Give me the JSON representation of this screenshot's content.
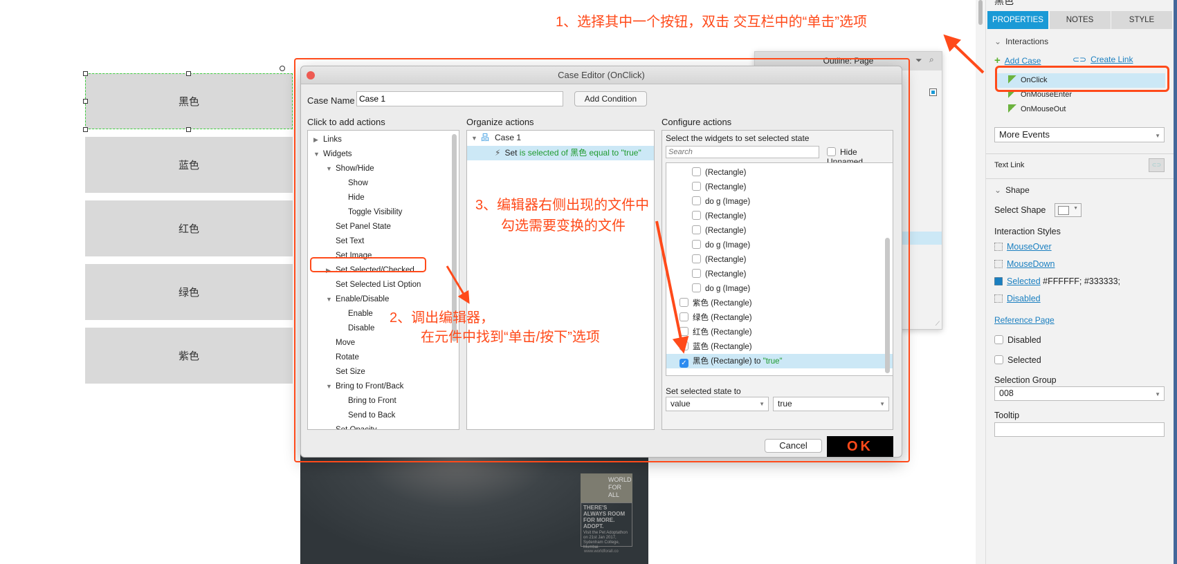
{
  "canvas": {
    "buttons": [
      "黑色",
      "蓝色",
      "红色",
      "绿色",
      "紫色"
    ]
  },
  "outline_panel": {
    "title": "Outline: Page"
  },
  "dialog": {
    "title": "Case Editor (OnClick)",
    "case_name_label": "Case Name",
    "case_name_value": "Case 1",
    "add_condition": "Add Condition",
    "left": {
      "header": "Click to add actions",
      "items": [
        {
          "label": "Links",
          "level": 0,
          "tri": "▶"
        },
        {
          "label": "Widgets",
          "level": 0,
          "tri": "▼"
        },
        {
          "label": "Show/Hide",
          "level": 1,
          "tri": "▼"
        },
        {
          "label": "Show",
          "level": 2,
          "tri": ""
        },
        {
          "label": "Hide",
          "level": 2,
          "tri": ""
        },
        {
          "label": "Toggle Visibility",
          "level": 2,
          "tri": ""
        },
        {
          "label": "Set Panel State",
          "level": 1,
          "tri": ""
        },
        {
          "label": "Set Text",
          "level": 1,
          "tri": ""
        },
        {
          "label": "Set Image",
          "level": 1,
          "tri": ""
        },
        {
          "label": "Set Selected/Checked",
          "level": 1,
          "tri": "▶"
        },
        {
          "label": "Set Selected List Option",
          "level": 1,
          "tri": ""
        },
        {
          "label": "Enable/Disable",
          "level": 1,
          "tri": "▼"
        },
        {
          "label": "Enable",
          "level": 2,
          "tri": ""
        },
        {
          "label": "Disable",
          "level": 2,
          "tri": ""
        },
        {
          "label": "Move",
          "level": 1,
          "tri": ""
        },
        {
          "label": "Rotate",
          "level": 1,
          "tri": ""
        },
        {
          "label": "Set Size",
          "level": 1,
          "tri": ""
        },
        {
          "label": "Bring to Front/Back",
          "level": 1,
          "tri": "▼"
        },
        {
          "label": "Bring to Front",
          "level": 2,
          "tri": ""
        },
        {
          "label": "Send to Back",
          "level": 2,
          "tri": ""
        },
        {
          "label": "Set Opacity",
          "level": 1,
          "tri": ""
        }
      ]
    },
    "middle": {
      "header": "Organize actions",
      "case_label": "Case 1",
      "action_verb": "Set",
      "action_detail": "is selected of 黑色 equal to \"true\""
    },
    "right": {
      "header": "Configure actions",
      "subheader": "Select the widgets to set selected state",
      "search_placeholder": "Search",
      "hide_unnamed": "Hide Unnamed",
      "widgets": [
        {
          "label": "(Rectangle)",
          "indent": 2,
          "checked": false
        },
        {
          "label": "(Rectangle)",
          "indent": 2,
          "checked": false
        },
        {
          "label": "do g (Image)",
          "indent": 2,
          "checked": false
        },
        {
          "label": "(Rectangle)",
          "indent": 2,
          "checked": false
        },
        {
          "label": "(Rectangle)",
          "indent": 2,
          "checked": false
        },
        {
          "label": "do g (Image)",
          "indent": 2,
          "checked": false
        },
        {
          "label": "(Rectangle)",
          "indent": 2,
          "checked": false
        },
        {
          "label": "(Rectangle)",
          "indent": 2,
          "checked": false
        },
        {
          "label": "do g (Image)",
          "indent": 2,
          "checked": false
        },
        {
          "label": "紫色 (Rectangle)",
          "indent": 1,
          "checked": false
        },
        {
          "label": "绿色 (Rectangle)",
          "indent": 1,
          "checked": false
        },
        {
          "label": "红色 (Rectangle)",
          "indent": 1,
          "checked": false
        },
        {
          "label": "蓝色 (Rectangle)",
          "indent": 1,
          "checked": false
        },
        {
          "label": "黑色 (Rectangle)",
          "indent": 1,
          "checked": true,
          "suffix": " to ",
          "value": "\"true\""
        }
      ],
      "set_state_label": "Set selected state to",
      "mode_value": "value",
      "state_value": "true"
    },
    "cancel": "Cancel",
    "ok": "OK"
  },
  "poster": {
    "logo": "WORLD FOR ALL",
    "headline": "THERE'S ALWAYS ROOM FOR MORE. ADOPT.",
    "body": "Visit the Pet Adoptathon on 21st Jan 2017, Sydenham College, Mumbai.",
    "url": "www.worldforall.co"
  },
  "right_panel": {
    "top_title": "黑色",
    "tabs": [
      "PROPERTIES",
      "NOTES",
      "STYLE"
    ],
    "interactions_header": "Interactions",
    "add_case": "Add Case",
    "create_link": "Create Link",
    "events": [
      "OnClick",
      "OnMouseEnter",
      "OnMouseOut"
    ],
    "more_events": "More Events",
    "text_link": "Text Link",
    "shape_header": "Shape",
    "select_shape": "Select Shape",
    "interaction_styles": "Interaction Styles",
    "styles": [
      {
        "label": "MouseOver",
        "value": ""
      },
      {
        "label": "MouseDown",
        "value": ""
      },
      {
        "label": "Selected",
        "value": "#FFFFFF; #333333;"
      },
      {
        "label": "Disabled",
        "value": ""
      }
    ],
    "reference_page": "Reference Page",
    "disabled": "Disabled",
    "selected": "Selected",
    "selection_group_label": "Selection Group",
    "selection_group_value": "008",
    "tooltip_label": "Tooltip",
    "tooltip_value": ""
  },
  "annotations": {
    "step1": "1、选择其中一个按钮，双击 交互栏中的“单击”选项",
    "step2_line1": "2、调出编辑器，",
    "step2_line2": "在元件中找到“单击/按下”选项",
    "step3_line1": "3、编辑器右侧出现的文件中",
    "step3_line2": "勾选需要变换的文件"
  },
  "colors": {
    "accent": "#1a9ad6",
    "annotation": "#ff4a1a",
    "selection": "#cce8f6",
    "canvas_button": "#d9d9d9"
  }
}
